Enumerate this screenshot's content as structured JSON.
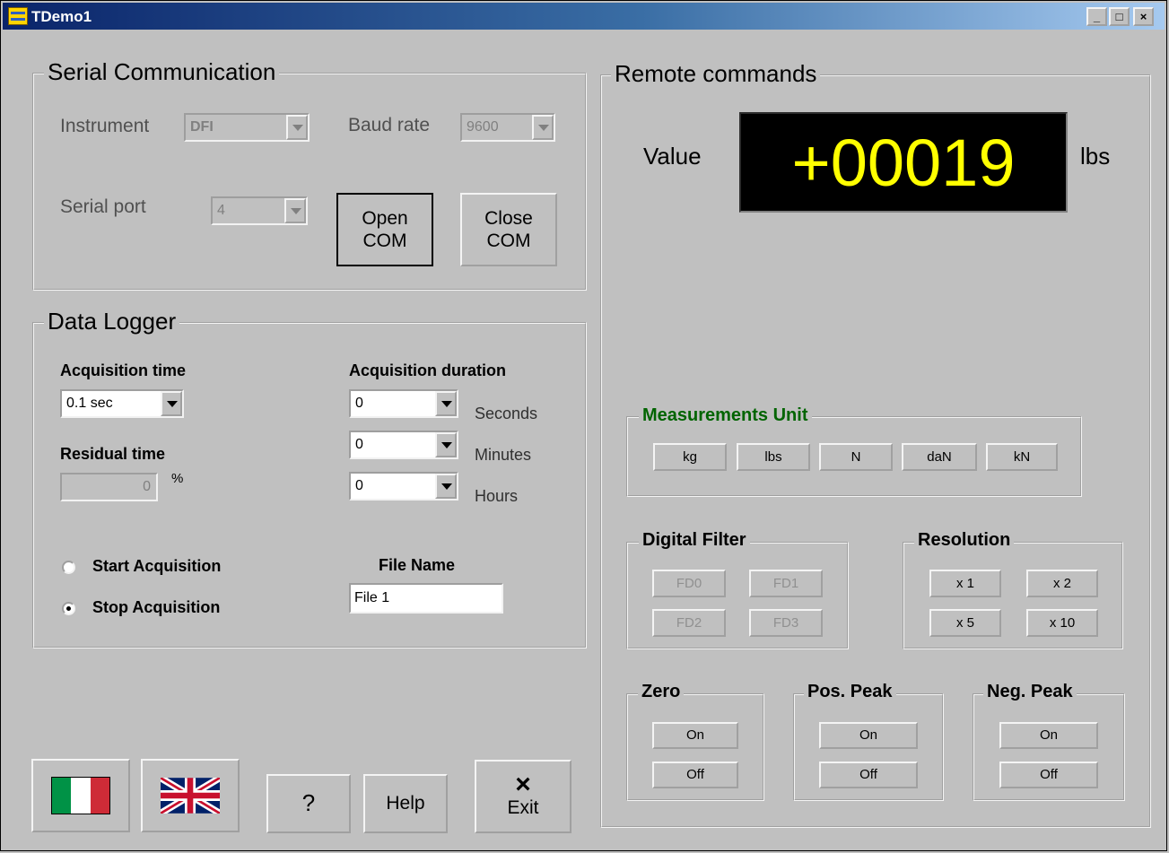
{
  "window": {
    "title": "TDemo1",
    "min_label": "_",
    "max_label": "□",
    "close_label": "×"
  },
  "serial": {
    "legend": "Serial Communication",
    "instrument_label": "Instrument",
    "instrument_value": "DFI",
    "baud_label": "Baud rate",
    "baud_value": "9600",
    "port_label": "Serial port",
    "port_value": "4",
    "open_label": "Open\nCOM",
    "close_label": "Close\nCOM"
  },
  "logger": {
    "legend": "Data Logger",
    "acq_time_label": "Acquisition time",
    "acq_time_value": "0.1 sec",
    "residual_label": "Residual time",
    "residual_value": "0",
    "residual_unit": "%",
    "duration_label": "Acquisition duration",
    "seconds_value": "0",
    "seconds_label": "Seconds",
    "minutes_value": "0",
    "minutes_label": "Minutes",
    "hours_value": "0",
    "hours_label": "Hours",
    "start_label": "Start Acquisition",
    "stop_label": "Stop Acquisition",
    "selected": "stop",
    "filename_label": "File Name",
    "filename_value": "File 1"
  },
  "footer": {
    "help_q_label": "?",
    "help_label": "Help",
    "exit_icon": "×",
    "exit_label": "Exit",
    "flags": [
      "italy-flag-icon",
      "uk-flag-icon"
    ]
  },
  "remote": {
    "legend": "Remote commands",
    "value_label": "Value",
    "value": "+00019",
    "unit": "lbs",
    "display_color": "#ffff00",
    "measure_legend": "Measurements Unit",
    "measure_color": "#006400",
    "units": [
      "kg",
      "lbs",
      "N",
      "daN",
      "kN"
    ],
    "filter_legend": "Digital Filter",
    "filters": [
      "FD0",
      "FD1",
      "FD2",
      "FD3"
    ],
    "resolution_legend": "Resolution",
    "resolutions": [
      "x 1",
      "x 2",
      "x 5",
      "x 10"
    ],
    "zero_legend": "Zero",
    "pos_legend": "Pos. Peak",
    "neg_legend": "Neg. Peak",
    "on_label": "On",
    "off_label": "Off"
  }
}
